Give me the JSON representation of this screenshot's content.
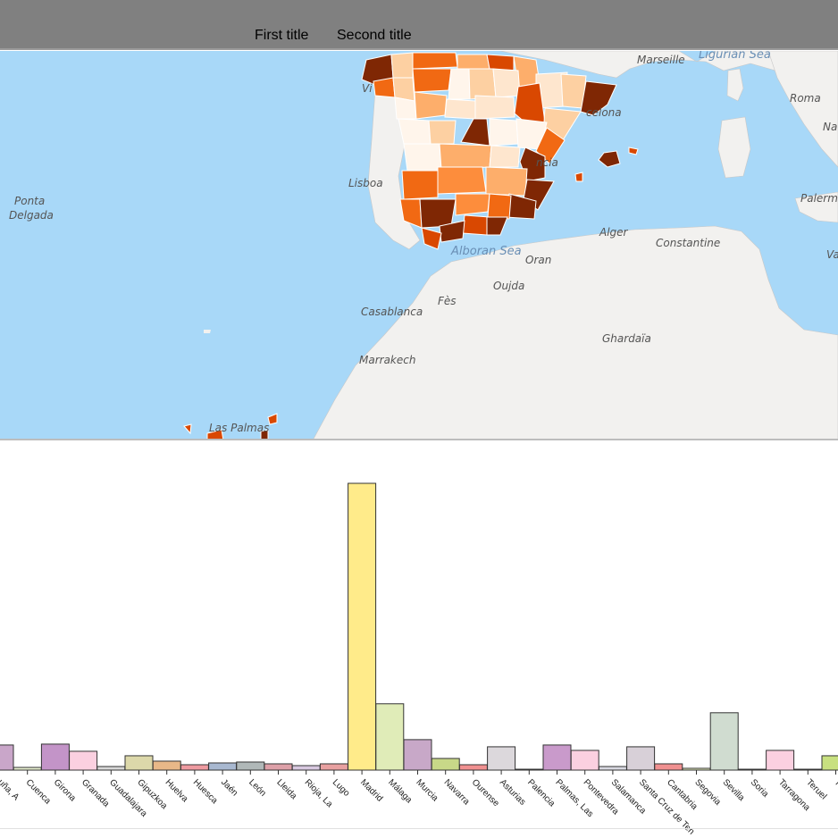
{
  "header": {
    "tabs": [
      {
        "label": "First title"
      },
      {
        "label": "Second title"
      }
    ]
  },
  "map": {
    "labels": {
      "marseille": "Marseille",
      "ligurian": "Ligurian Sea",
      "roma": "Roma",
      "na": "Na",
      "barcelona": "celona",
      "valencia": "ncia",
      "lisboa": "Lisboa",
      "ponta": "Ponta",
      "delgada": "Delgada",
      "palermo": "Palermo",
      "alger": "Alger",
      "constantine": "Constantine",
      "va": "Va",
      "alboran": "Alboran Sea",
      "oran": "Oran",
      "oujda": "Oujda",
      "fes": "Fès",
      "casablanca": "Casablanca",
      "ghardaia": "Ghardaïa",
      "marrakech": "Marrakech",
      "laspalmas": "Las Palmas",
      "vi": "Vi"
    },
    "colors": {
      "sea": "#a8d8f8",
      "land": "#f2f1ef",
      "dark": "#7f2704",
      "red": "#d94801",
      "orange": "#f16913",
      "mid": "#fd8d3c",
      "light": "#fdae6b",
      "pale": "#fdd0a2",
      "paler": "#fee6ce",
      "palest": "#fff5eb"
    }
  },
  "chart_data": {
    "type": "bar",
    "categories": [
      "Coruña, A",
      "Cuenca",
      "Girona",
      "Granada",
      "Guadalajara",
      "Gipuzkoa",
      "Huelva",
      "Huesca",
      "Jaén",
      "León",
      "Lleida",
      "Rioja, La",
      "Lugo",
      "Madrid",
      "Málaga",
      "Murcia",
      "Navarra",
      "Ourense",
      "Asturias",
      "Palencia",
      "Palmas, Las",
      "Pontevedra",
      "Salamanca",
      "Santa Cruz de Tenerife",
      "Cantabria",
      "Segovia",
      "Sevilla",
      "Soria",
      "Tarragona",
      "Teruel",
      "Toledo"
    ],
    "tick_labels": [
      "uña, A",
      "Cuenca",
      "Girona",
      "Granada",
      "Guadalajara",
      "Gipuzkoa",
      "Huelva",
      "Huesca",
      "Jaén",
      "León",
      "Lleida",
      "Rioja, La",
      "Lugo",
      "Madrid",
      "Málaga",
      "Murcia",
      "Navarra",
      "Ourense",
      "Asturias",
      "Palencia",
      "Palmas, Las",
      "Pontevedra",
      "Salamanca",
      "Santa Cruz de Ten",
      "Cantabria",
      "Segovia",
      "Sevilla",
      "Soria",
      "Tarragona",
      "Teruel",
      "Tole"
    ],
    "values": [
      28,
      3,
      29,
      21,
      4,
      16,
      10,
      6,
      8,
      9,
      7,
      5,
      7,
      320,
      74,
      34,
      13,
      6,
      26,
      1,
      28,
      22,
      4,
      26,
      7,
      2,
      64,
      1,
      22,
      1,
      16
    ],
    "colors": [
      "#c9a6c9",
      "#e8f0d0",
      "#c394c8",
      "#fbd0e0",
      "#d8d8d8",
      "#dcd8aa",
      "#e8b888",
      "#ee9aa0",
      "#a8b8d0",
      "#b0b8b8",
      "#dda0a8",
      "#d8c8e0",
      "#e8a0a0",
      "#ffeb8a",
      "#e0ecb8",
      "#c8a8c8",
      "#c8d888",
      "#f09090",
      "#dcd8dc",
      "#b8d8b8",
      "#c99acb",
      "#fbd0e0",
      "#d8d8e0",
      "#d8d0d8",
      "#f09090",
      "#e8f0c0",
      "#d0dcd0",
      "#b8d8c8",
      "#fbd0e0",
      "#c8e8d0",
      "#c8e080"
    ],
    "ylim": [
      0,
      330
    ],
    "xlabel": "",
    "ylabel": "",
    "title": ""
  }
}
